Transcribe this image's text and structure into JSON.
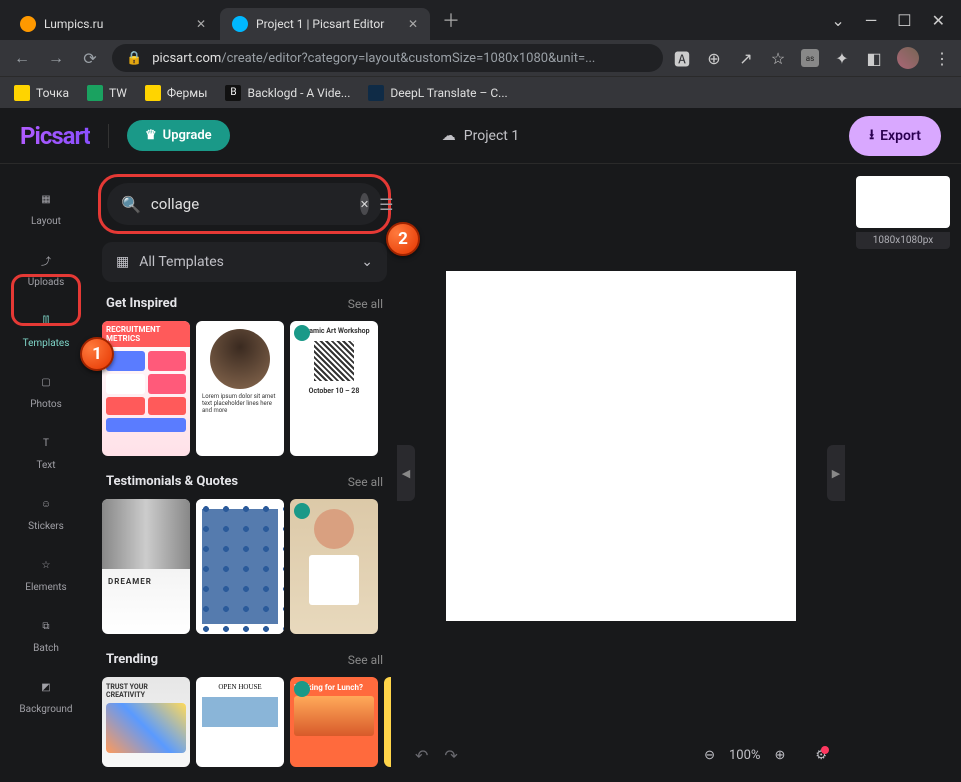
{
  "browser": {
    "tabs": [
      {
        "title": "Lumpics.ru",
        "favicon_color": "#ff9900"
      },
      {
        "title": "Project 1 | Picsart Editor",
        "favicon_color": "#00b8ff"
      }
    ],
    "url_display": "picsart.com/create/editor?category=layout&customSize=1080x1080&unit=...",
    "url_domain": "picsart.com",
    "url_path": "/create/editor?category=layout&customSize=1080x1080&unit=...",
    "bookmarks": [
      {
        "label": "Точка",
        "color": "#ffd400"
      },
      {
        "label": "TW",
        "color": "#1aa260"
      },
      {
        "label": "Фермы",
        "color": "#ffd400"
      },
      {
        "label": "Backlogd - A Vide...",
        "color": "#ffffff"
      },
      {
        "label": "DeepL Translate – C...",
        "color": "#0f2b46"
      }
    ]
  },
  "app": {
    "logo": "Picsart",
    "upgrade_label": "Upgrade",
    "project_name": "Project 1",
    "export_label": "Export"
  },
  "rail": {
    "items": [
      {
        "key": "layout",
        "label": "Layout"
      },
      {
        "key": "uploads",
        "label": "Uploads"
      },
      {
        "key": "templates",
        "label": "Templates"
      },
      {
        "key": "photos",
        "label": "Photos"
      },
      {
        "key": "text",
        "label": "Text"
      },
      {
        "key": "stickers",
        "label": "Stickers"
      },
      {
        "key": "elements",
        "label": "Elements"
      },
      {
        "key": "batch",
        "label": "Batch"
      },
      {
        "key": "background",
        "label": "Background"
      }
    ]
  },
  "panel": {
    "search_value": "collage",
    "all_templates_label": "All Templates",
    "see_all_label": "See all",
    "sections": [
      {
        "title": "Get Inspired",
        "see_all": "See all",
        "items": [
          "RECRUITMENT METRICS",
          "",
          "Ceramic Art Workshop",
          "October 10 – 28"
        ]
      },
      {
        "title": "Testimonials & Quotes",
        "see_all": "See all",
        "items": [
          "DREAMER",
          "",
          ""
        ]
      },
      {
        "title": "Trending",
        "see_all": "See all",
        "items": [
          "TRUST YOUR CREATIVITY",
          "OPEN HOUSE",
          "Looking for Lunch?",
          ""
        ]
      }
    ]
  },
  "canvas": {
    "zoom_label": "100%",
    "dimensions_label": "1080x1080px"
  },
  "callouts": {
    "one": "1",
    "two": "2"
  }
}
